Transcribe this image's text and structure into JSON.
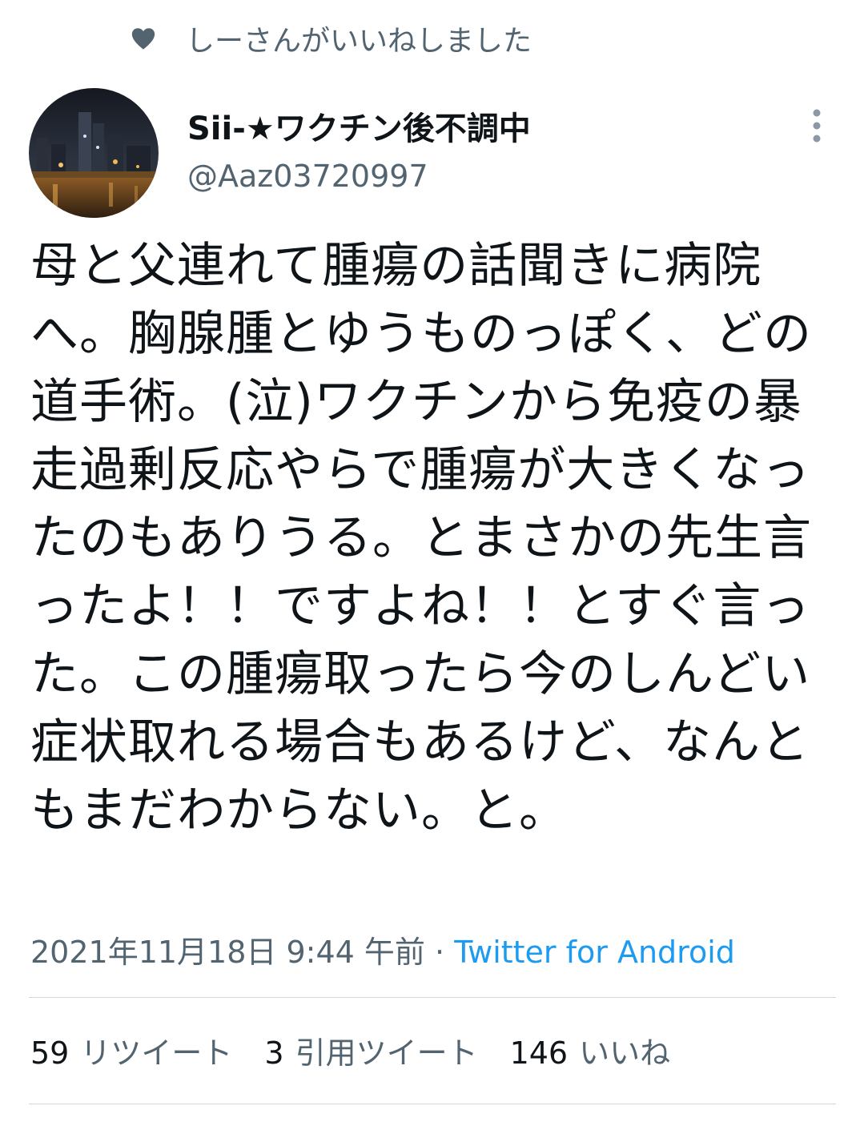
{
  "social_context": {
    "icon": "heart-icon",
    "text": "しーさんがいいねしました"
  },
  "author": {
    "display_name": "Sii-★ワクチン後不調中",
    "handle": "@Aaz03720997",
    "avatar": "avatar-image"
  },
  "more_icon": "more-vertical-icon",
  "tweet": {
    "text": "母と父連れて腫瘍の話聞きに病院へ。胸腺腫とゆうものっぽく、どの道手術。(泣)ワクチンから免疫の暴走過剰反応やらで腫瘍が大きくなったのもありうる。とまさかの先生言ったよ！！ですよね！！とすぐ言った。この腫瘍取ったら今のしんどい症状取れる場合もあるけど、なんともまだわからない。と。",
    "timestamp": "2021年11月18日 9:44 午前",
    "separator": "·",
    "source": "Twitter for Android"
  },
  "stats": {
    "retweets": {
      "count": "59",
      "label": "リツイート"
    },
    "quotes": {
      "count": "3",
      "label": "引用ツイート"
    },
    "likes": {
      "count": "146",
      "label": "いいね"
    }
  },
  "colors": {
    "primary_text": "#0f1419",
    "secondary_text": "#536471",
    "link": "#1d9bf0",
    "divider": "#cfd9de"
  }
}
